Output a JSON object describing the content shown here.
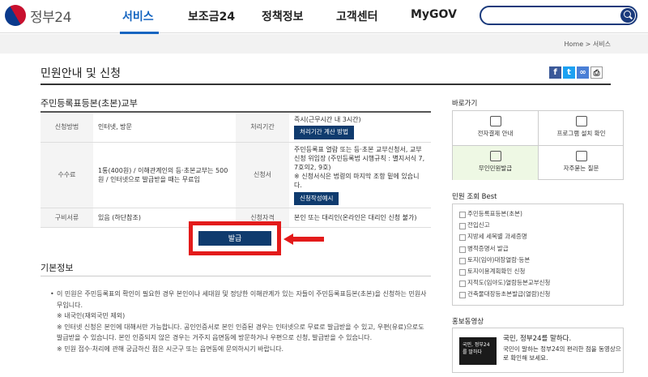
{
  "header": {
    "logo_text": "정부24",
    "nav": [
      {
        "label": "서비스",
        "active": true
      },
      {
        "label": "보조금24",
        "active": false
      },
      {
        "label": "정책정보",
        "active": false
      },
      {
        "label": "고객센터",
        "active": false
      },
      {
        "label": "MyGOV",
        "active": false
      }
    ],
    "search_placeholder": ""
  },
  "breadcrumb": "Home > 서비스",
  "page_title": "민원안내 및 신청",
  "share_icons": [
    "facebook-icon",
    "twitter-icon",
    "link-icon",
    "print-icon"
  ],
  "service_name": "주민등록표등본(초본)교부",
  "table": {
    "method_label": "신청방법",
    "method_value": "인터넷, 방문",
    "period_label": "처리기간",
    "period_value": "즉시(근무시간 내 3시간)",
    "period_button": "처리기간 계산 방법",
    "fee_label": "수수료",
    "fee_value": "1통(400원) / 이해관계인의 등·초본교부는 500원 / 인터넷으로 발급받을 때는 무료임",
    "form_label": "신청서",
    "form_value": "주민등록표 열람 또는 등·초본 교부신청서, 교부신청 위임장 (주민등록법 시행규칙 : 별지서식 7, 7호의2, 9호)",
    "form_note": "※ 신청서식은 법령의 마지막 조항 밑에 있습니다.",
    "form_button": "신청작성예시",
    "docs_label": "구비서류",
    "docs_value": "있음 (하단참조)",
    "qual_label": "신청자격",
    "qual_value": "본인 또는 대리인(온라인은 대리인 신청 불가)"
  },
  "issue_button": "발급",
  "basic_info": {
    "title": "기본정보",
    "line1": "이 민원은 주민등록표의 확인이 필요한 경우 본인이나 세대원 및 정당한 이해관계가 있는 자들이 주민등록표등본(초본)을 신청하는 민원사무입니다.",
    "line2": "※ 내국인(재외국민 제외)",
    "line3": "※ 인터넷 신청은 본인에 대해서만 가능합니다. 공인인증서로 본인 인증된 경우는 인터넷으로 무료로 발급받을 수 있고, 우편(유료)으로도 발급받을 수 있습니다. 본인 인증되지 않은 경우는 거주지 읍면동에 방문하거나 우편으로 신청, 발급받을 수 있습니다.",
    "line4": "※ 민원 접수·처리에 관해 궁금하신 점은 시군구 또는 읍면동에 문의하시기 바랍니다."
  },
  "side": {
    "shortcut_title": "바로가기",
    "shortcuts": [
      {
        "label": "전자결제 안내",
        "icon": "download-icon"
      },
      {
        "label": "프로그램 설치 확인",
        "icon": "monitor-icon"
      },
      {
        "label": "무인민원발급",
        "icon": "kiosk-icon",
        "selected": true
      },
      {
        "label": "자주묻는 질문",
        "icon": "chat-icon"
      }
    ],
    "best_title": "민원 조회 Best",
    "best_items": [
      "주민등록표등본(초본)",
      "전입신고",
      "지방세 세목별 과세증명",
      "병적증명서 발급",
      "토지(임야)대장열람·등본",
      "토지이용계획확인 신청",
      "지적도(임야도)열람등본교부신청",
      "건축물대장등초본발급(열람)신청"
    ],
    "promo_title": "홍보동영상",
    "promo_heading": "국민, 정부24를 말하다.",
    "promo_text": "국민이 말하는 정부24의 편리한 점을 동영상으로 확인해 보세요.",
    "promo_thumb_text": "국민, 정부24를 말하다"
  }
}
